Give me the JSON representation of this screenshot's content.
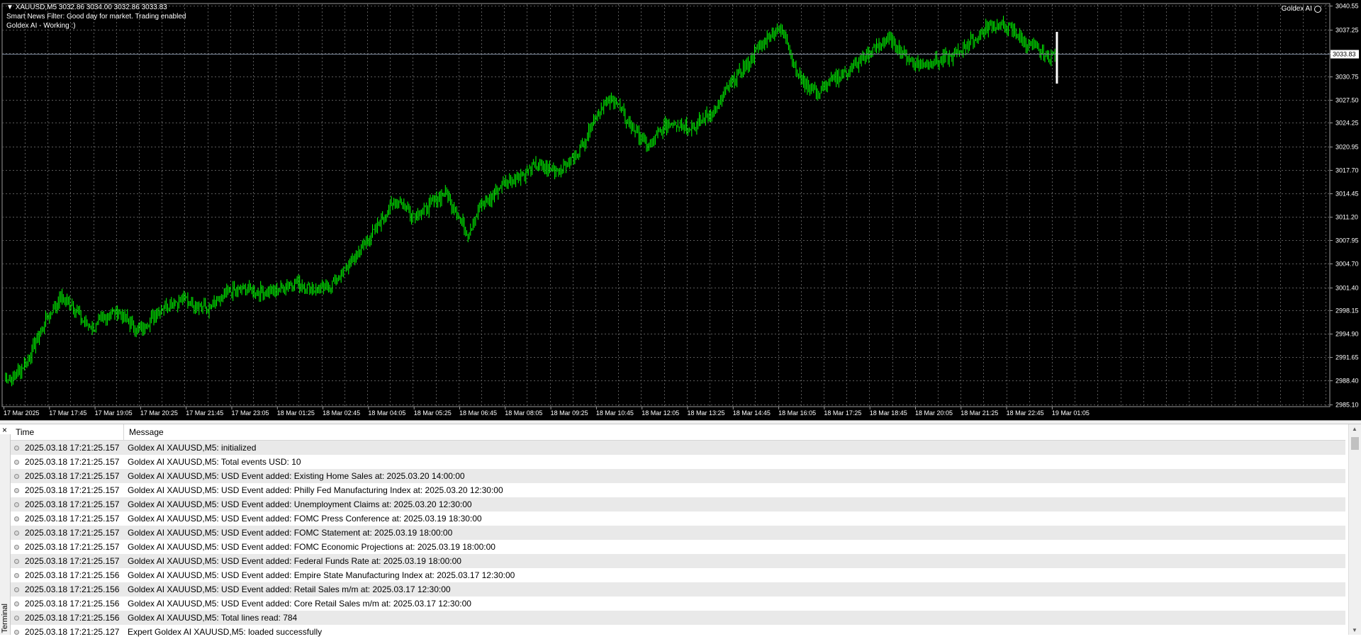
{
  "chart": {
    "symbol_line": "XAUUSD,M5  3032.86 3034.00 3032.86 3033.83",
    "news_filter": "Smart News Filter: Good day for market. Trading enabled",
    "ea_status": "Goldex AI - Working :)",
    "ea_badge": "Goldex AI",
    "current_price": "3033.83",
    "colors": {
      "background": "#000000",
      "candle": "#00ff00",
      "grid": "#5a5a5a",
      "text": "#ffffff",
      "price_line": "#7a869a"
    },
    "chart_data": {
      "type": "line",
      "x_labels": [
        "17 Mar 2025",
        "17 Mar 17:45",
        "17 Mar 19:05",
        "17 Mar 20:25",
        "17 Mar 21:45",
        "17 Mar 23:05",
        "18 Mar 01:25",
        "18 Mar 02:45",
        "18 Mar 04:05",
        "18 Mar 05:25",
        "18 Mar 06:45",
        "18 Mar 08:05",
        "18 Mar 09:25",
        "18 Mar 10:45",
        "18 Mar 12:05",
        "18 Mar 13:25",
        "18 Mar 14:45",
        "18 Mar 16:05",
        "18 Mar 17:25",
        "18 Mar 18:45",
        "18 Mar 20:05",
        "18 Mar 21:25",
        "18 Mar 22:45",
        "19 Mar 01:05"
      ],
      "y_ticks": [
        "3040.55",
        "3037.25",
        "3034.00",
        "3030.75",
        "3027.50",
        "3024.25",
        "3020.95",
        "3017.70",
        "3014.45",
        "3011.20",
        "3007.95",
        "3004.70",
        "3001.40",
        "2998.15",
        "2994.90",
        "2991.65",
        "2988.40",
        "2985.10"
      ],
      "ylim": [
        2985.1,
        3040.55
      ],
      "series": [
        {
          "values": [
            2988.5,
            2989.3,
            2991.0,
            2994.6,
            2997.8,
            2999.9,
            2999.2,
            2996.6,
            2995.7,
            2997.6,
            2998.1,
            2996.7,
            2995.3,
            2997.1,
            2998.6,
            2999.3,
            2999.8,
            2999.0,
            2998.4,
            2999.5,
            3000.8,
            3001.2,
            3001.0,
            3000.6,
            3001.0,
            3001.8,
            3002.1,
            3001.3,
            3000.9,
            3002.0,
            3003.6,
            3005.8,
            3007.7,
            3009.9,
            3012.4,
            3013.6,
            3011.6,
            3012.0,
            3013.2,
            3014.6,
            3011.8,
            3008.8,
            3012.6,
            3013.7,
            3015.8,
            3016.6,
            3017.2,
            3018.3,
            3017.9,
            3017.6,
            3018.9,
            3020.7,
            3024.6,
            3026.9,
            3027.6,
            3024.6,
            3022.8,
            3020.9,
            3023.1,
            3024.4,
            3024.1,
            3023.6,
            3025.1,
            3026.2,
            3029.1,
            3031.1,
            3033.1,
            3035.3,
            3037.0,
            3036.9,
            3031.1,
            3029.6,
            3028.4,
            3029.9,
            3030.9,
            3032.0,
            3033.3,
            3034.6,
            3035.9,
            3034.8,
            3033.0,
            3032.3,
            3032.6,
            3033.1,
            3033.6,
            3035.1,
            3036.1,
            3037.6,
            3037.9,
            3037.2,
            3035.8,
            3034.6,
            3033.6,
            3033.83
          ]
        }
      ]
    }
  },
  "journal": {
    "close_label": "×",
    "side_tab_label": "Terminal",
    "columns": {
      "time": "Time",
      "message": "Message"
    },
    "rows": [
      {
        "time": "2025.03.18 17:21:25.157",
        "message": "Goldex AI XAUUSD,M5: initialized"
      },
      {
        "time": "2025.03.18 17:21:25.157",
        "message": "Goldex AI XAUUSD,M5: Total events USD: 10"
      },
      {
        "time": "2025.03.18 17:21:25.157",
        "message": "Goldex AI XAUUSD,M5: USD Event added: Existing Home Sales at: 2025.03.20 14:00:00"
      },
      {
        "time": "2025.03.18 17:21:25.157",
        "message": "Goldex AI XAUUSD,M5: USD Event added: Philly Fed Manufacturing Index at: 2025.03.20 12:30:00"
      },
      {
        "time": "2025.03.18 17:21:25.157",
        "message": "Goldex AI XAUUSD,M5: USD Event added: Unemployment Claims at: 2025.03.20 12:30:00"
      },
      {
        "time": "2025.03.18 17:21:25.157",
        "message": "Goldex AI XAUUSD,M5: USD Event added: FOMC Press Conference at: 2025.03.19 18:30:00"
      },
      {
        "time": "2025.03.18 17:21:25.157",
        "message": "Goldex AI XAUUSD,M5: USD Event added: FOMC Statement at: 2025.03.19 18:00:00"
      },
      {
        "time": "2025.03.18 17:21:25.157",
        "message": "Goldex AI XAUUSD,M5: USD Event added: FOMC Economic Projections at: 2025.03.19 18:00:00"
      },
      {
        "time": "2025.03.18 17:21:25.157",
        "message": "Goldex AI XAUUSD,M5: USD Event added: Federal Funds Rate at: 2025.03.19 18:00:00"
      },
      {
        "time": "2025.03.18 17:21:25.156",
        "message": "Goldex AI XAUUSD,M5: USD Event added: Empire State Manufacturing Index at: 2025.03.17 12:30:00"
      },
      {
        "time": "2025.03.18 17:21:25.156",
        "message": "Goldex AI XAUUSD,M5: USD Event added: Retail Sales m/m at: 2025.03.17 12:30:00"
      },
      {
        "time": "2025.03.18 17:21:25.156",
        "message": "Goldex AI XAUUSD,M5: USD Event added: Core Retail Sales m/m at: 2025.03.17 12:30:00"
      },
      {
        "time": "2025.03.18 17:21:25.156",
        "message": "Goldex AI XAUUSD,M5: Total lines read: 784"
      },
      {
        "time": "2025.03.18 17:21:25.127",
        "message": "Expert Goldex AI XAUUSD,M5: loaded successfully"
      }
    ]
  }
}
